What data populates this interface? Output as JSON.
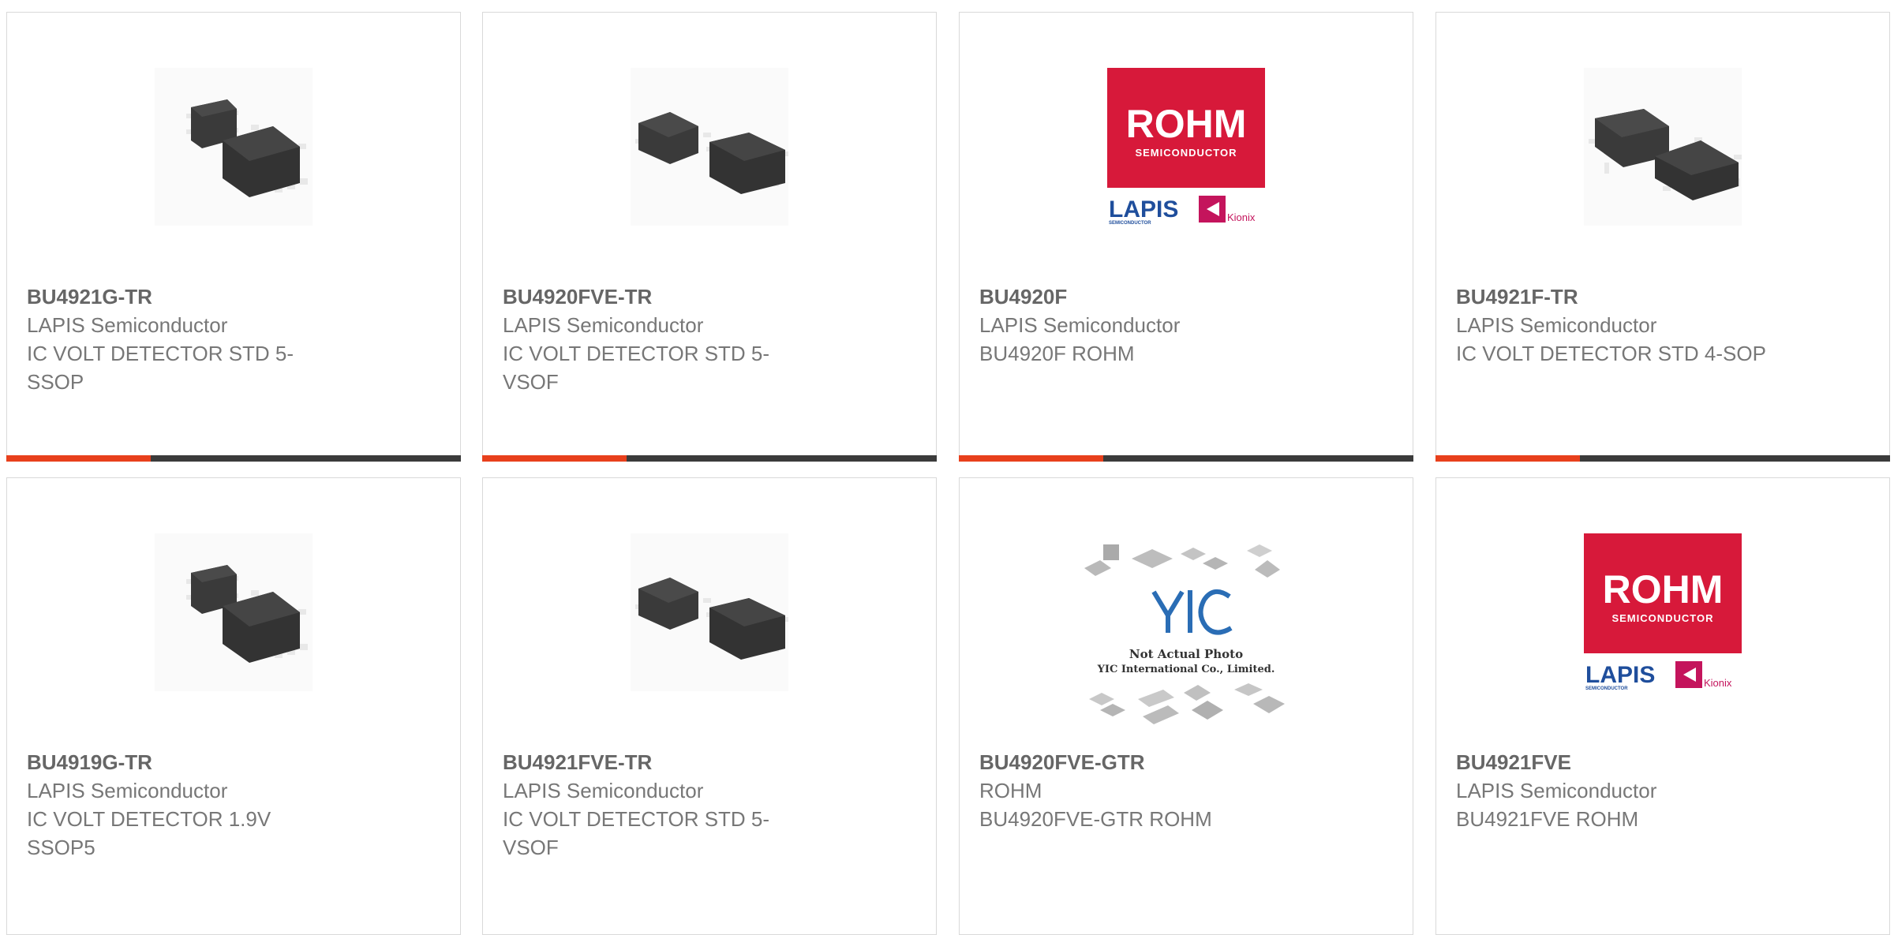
{
  "colors": {
    "accent": "#e8401c",
    "bar_dark": "#3b3b3b",
    "rohm_red": "#d7193a",
    "lapis_blue": "#1f4e9c"
  },
  "products": [
    {
      "part": "BU4921G-TR",
      "manufacturer": "LAPIS Semiconductor",
      "description": "IC VOLT DETECTOR STD 5-SSOP",
      "image": "ssop5-chip-photo"
    },
    {
      "part": "BU4920FVE-TR",
      "manufacturer": "LAPIS Semiconductor",
      "description": "IC VOLT DETECTOR STD 5-VSOF",
      "image": "vsof5-chip-photo"
    },
    {
      "part": "BU4920F",
      "manufacturer": "LAPIS Semiconductor",
      "description": "BU4920F ROHM",
      "image": "rohm-logo",
      "logo": {
        "rohm": "ROHM",
        "semiconductor": "SEMICONDUCTOR",
        "lapis": "LAPIS",
        "lapis_sub": "SEMICONDUCTOR",
        "kionix": "Kionix"
      }
    },
    {
      "part": "BU4921F-TR",
      "manufacturer": "LAPIS Semiconductor",
      "description": "IC VOLT DETECTOR STD 4-SOP",
      "image": "sop4-chip-photo"
    },
    {
      "part": "BU4919G-TR",
      "manufacturer": "LAPIS Semiconductor",
      "description": "IC VOLT DETECTOR 1.9V SSOP5",
      "image": "ssop5-chip-photo"
    },
    {
      "part": "BU4921FVE-TR",
      "manufacturer": "LAPIS Semiconductor",
      "description": "IC VOLT DETECTOR STD 5-VSOF",
      "image": "vsof5-chip-photo"
    },
    {
      "part": "BU4920FVE-GTR",
      "manufacturer": "ROHM",
      "description": "BU4920FVE-GTR ROHM",
      "image": "yic-placeholder",
      "placeholder": {
        "logo": "YIC",
        "line1": "Not Actual Photo",
        "line2": "YIC International Co., Limited."
      }
    },
    {
      "part": "BU4921FVE",
      "manufacturer": "LAPIS Semiconductor",
      "description": "BU4921FVE ROHM",
      "image": "rohm-logo",
      "logo": {
        "rohm": "ROHM",
        "semiconductor": "SEMICONDUCTOR",
        "lapis": "LAPIS",
        "lapis_sub": "SEMICONDUCTOR",
        "kionix": "Kionix"
      }
    }
  ]
}
